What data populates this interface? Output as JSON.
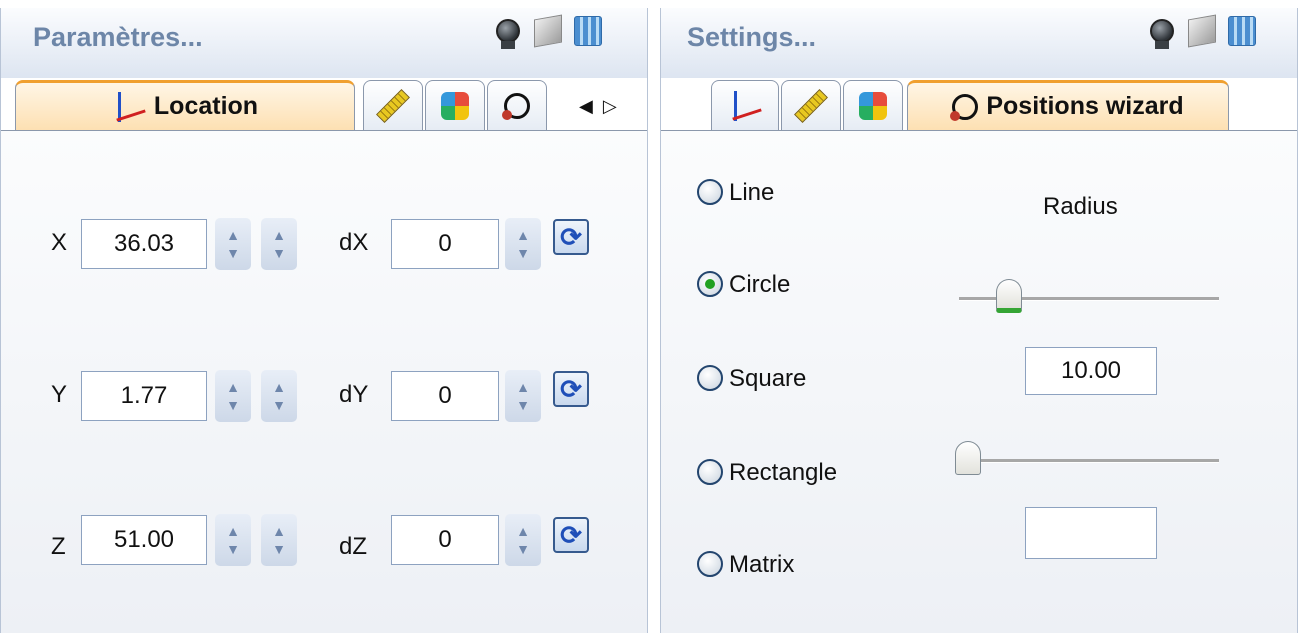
{
  "left_panel": {
    "title": "Paramètres...",
    "tool_icons": [
      "camera-icon",
      "cube-icon",
      "cube-grid-icon"
    ],
    "tabs": [
      {
        "name": "location-tab",
        "label": "Location",
        "icon": "axes-icon",
        "active": true
      },
      {
        "name": "measure-tab",
        "icon": "ruler-icon",
        "active": false
      },
      {
        "name": "appearance-tab",
        "icon": "puzzle-icon",
        "active": false
      },
      {
        "name": "positions-tab",
        "icon": "circle-path-icon",
        "active": false
      }
    ],
    "scroll_arrows": [
      "◀",
      "▷"
    ],
    "rows": [
      {
        "axis": "X",
        "value": "36.03",
        "delta_label": "dX",
        "delta": "0"
      },
      {
        "axis": "Y",
        "value": "1.77",
        "delta_label": "dY",
        "delta": "0"
      },
      {
        "axis": "Z",
        "value": "51.00",
        "delta_label": "dZ",
        "delta": "0"
      }
    ],
    "spin_glyphs": {
      "up": "▲",
      "down": "▼"
    },
    "refresh_glyph": "⟳"
  },
  "right_panel": {
    "title": "Settings...",
    "tool_icons": [
      "camera-icon",
      "cube-icon",
      "cube-grid-icon"
    ],
    "tabs": [
      {
        "name": "location-tab",
        "icon": "axes-icon",
        "active": false
      },
      {
        "name": "measure-tab",
        "icon": "ruler-icon",
        "active": false
      },
      {
        "name": "appearance-tab",
        "icon": "puzzle-icon",
        "active": false
      },
      {
        "name": "positions-wizard-tab",
        "label": "Positions wizard",
        "icon": "circle-path-icon",
        "active": true
      }
    ],
    "options": [
      {
        "label": "Line",
        "checked": false
      },
      {
        "label": "Circle",
        "checked": true
      },
      {
        "label": "Square",
        "checked": false
      },
      {
        "label": "Rectangle",
        "checked": false
      },
      {
        "label": "Matrix",
        "checked": false
      }
    ],
    "radius_label": "Radius",
    "radius_value": "10.00",
    "second_value": "",
    "radius_slider_level": 0.15,
    "second_slider_level": 0.0
  },
  "colors": {
    "title_text": "#6d86a8",
    "active_tab": "#fde0b2",
    "selected_radio": "#20a020"
  }
}
